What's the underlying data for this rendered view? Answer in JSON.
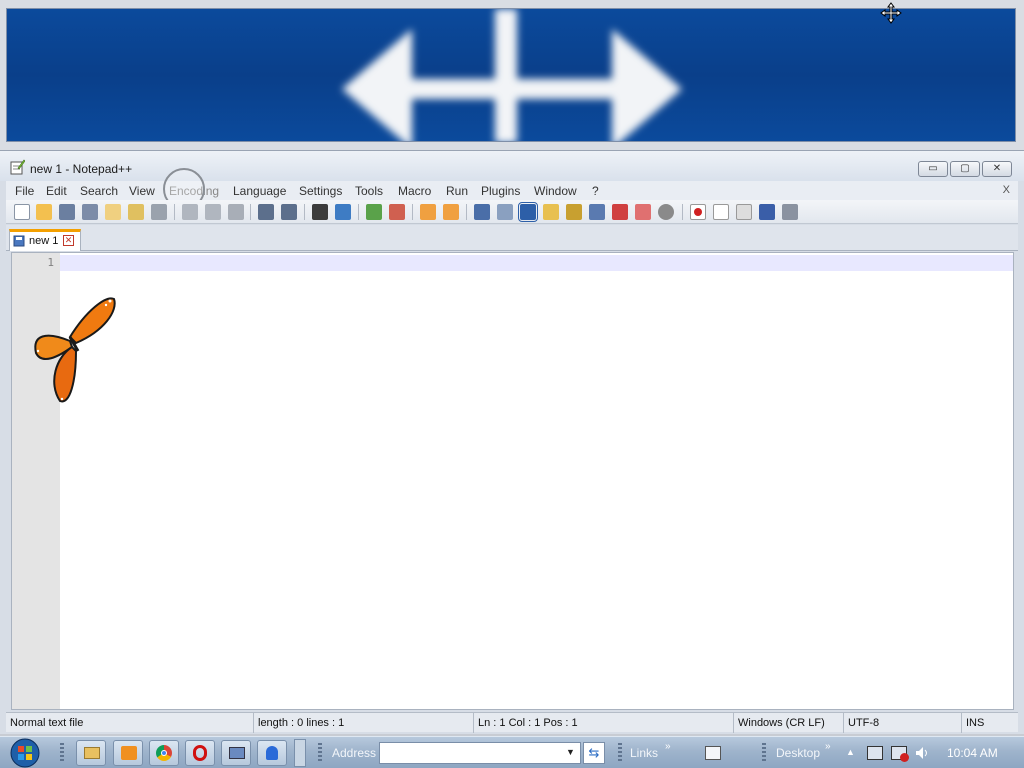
{
  "notepad": {
    "title": "new 1 - Notepad++",
    "window_buttons": {
      "minimize": "▭",
      "maximize": "▢",
      "close": "✕"
    },
    "menu": [
      "File",
      "Edit",
      "Search",
      "View",
      "Encoding",
      "Language",
      "Settings",
      "Tools",
      "Macro",
      "Run",
      "Plugins",
      "Window",
      "?"
    ],
    "menu_close": "X",
    "tab": {
      "label": "new 1",
      "close": "✕"
    },
    "editor": {
      "line_number": "1",
      "content": ""
    },
    "status": {
      "file_type": "Normal text file",
      "length_lines": "length : 0    lines : 1",
      "position": "Ln : 1    Col : 1    Pos : 1",
      "eol": "Windows (CR LF)",
      "encoding": "UTF-8",
      "mode": "INS"
    }
  },
  "taskbar": {
    "address_label": "Address",
    "address_value": "",
    "links_label": "Links",
    "desktop_label": "Desktop",
    "clock": "10:04 AM",
    "chevron": "»"
  },
  "icons": {
    "banner": "move-arrows-graphic",
    "cursor": "move-cursor-icon",
    "start": "windows-start-orb",
    "apps": [
      "explorer-icon",
      "media-player-icon",
      "chrome-icon",
      "opera-icon",
      "network-icon",
      "app-icon"
    ]
  },
  "colors": {
    "banner_blue": "#0b4a9c",
    "tab_accent": "#f4a000",
    "current_line": "#e8e8ff",
    "gutter": "#e4e4e4"
  }
}
